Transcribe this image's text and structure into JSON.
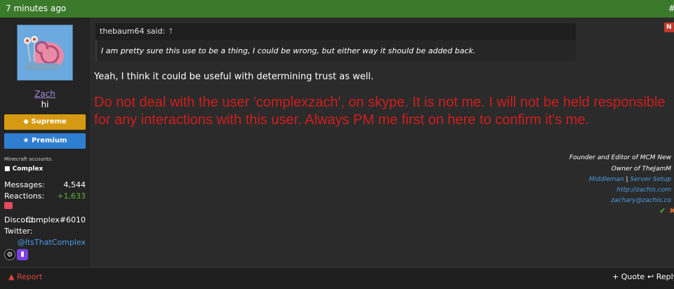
{
  "header": {
    "time": "7 minutes ago",
    "post_number": "#"
  },
  "user": {
    "name": "Zach",
    "title": "hi",
    "badges": [
      "Supreme",
      "Premium"
    ],
    "minecraft_label": "Minecraft accounts:",
    "minecraft_account": "Complex",
    "messages_label": "Messages:",
    "messages_value": "4,544",
    "reactions_label": "Reactions:",
    "reactions_value": "+1,633",
    "discord_label": "Discord:",
    "discord_value": "Complex#6010",
    "twitter_label": "Twitter:",
    "twitter_value": "@ItsThatComplex"
  },
  "quote": {
    "author": "thebaum64 said:",
    "arrow": "↑",
    "text": "I am pretty sure this use to be a thing, I could be wrong, but either way it should be added back."
  },
  "post": {
    "reply": "Yeah, I think it could be useful with determining trust as well.",
    "warning": "Do not deal with the user 'complexzach', on skype. It is not me. I will not be held responsible for any interactions with this user. Always PM me first on here to confirm it's me."
  },
  "signature": {
    "line1": "Founder and Editor of MCM New",
    "line2": "Owner of TheJamM",
    "link_middleman": "Middleman",
    "separator": "|",
    "link_server": "Server Setup",
    "link_site": "http://zachis.com",
    "link_email": "zachary@zachis.co"
  },
  "icons": {
    "steam": "steam-icon",
    "twitch": "twitch-icon",
    "warning": "warning-icon",
    "reply": "reply-icon"
  },
  "flags": {
    "new": "N"
  },
  "actions": {
    "report": "Report",
    "quote": "+ Quote",
    "reply": "Reply"
  },
  "colors": {
    "header_green": "#3c7a2b",
    "warning_red": "#d01d1d",
    "link_blue": "#4a9de8"
  }
}
